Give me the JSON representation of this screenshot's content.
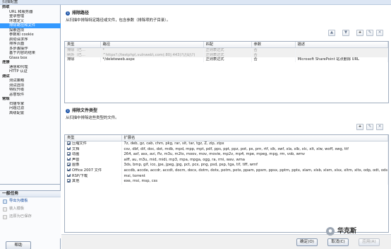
{
  "window": {
    "title": "扫描配置"
  },
  "sidebar": {
    "nav": [
      {
        "type": "group",
        "label": "抓取"
      },
      {
        "type": "item",
        "label": "URL 和服务器"
      },
      {
        "type": "item",
        "label": "登录管理"
      },
      {
        "type": "item",
        "label": "环境定义"
      },
      {
        "type": "item",
        "label": "排除路径和文件",
        "selected": true
      },
      {
        "type": "item",
        "label": "探索选项"
      },
      {
        "type": "item",
        "label": "参数和 cookie"
      },
      {
        "type": "item",
        "label": "启动请求序"
      },
      {
        "type": "item",
        "label": "排序页面"
      },
      {
        "type": "item",
        "label": "多步骤操作"
      },
      {
        "type": "item",
        "label": "基于内容的结果"
      },
      {
        "type": "item",
        "label": "Glass box"
      },
      {
        "type": "group",
        "label": "连接"
      },
      {
        "type": "item",
        "label": "通信和代理"
      },
      {
        "type": "item",
        "label": "HTTP 认证"
      },
      {
        "type": "group",
        "label": "测试"
      },
      {
        "type": "item",
        "label": "测试策略"
      },
      {
        "type": "item",
        "label": "测试选项"
      },
      {
        "type": "item",
        "label": "特权升级"
      },
      {
        "type": "item",
        "label": "恶意软件"
      },
      {
        "type": "group",
        "label": "常规"
      },
      {
        "type": "item",
        "label": "扫描专家"
      },
      {
        "type": "item",
        "label": "问题过滤"
      },
      {
        "type": "item",
        "label": "高级配置"
      }
    ],
    "tasks": {
      "header": "一般任务",
      "items": [
        {
          "label": "导出为模板",
          "enabled": true
        },
        {
          "label": "装入模板",
          "enabled": false
        },
        {
          "label": "还原为已保存",
          "enabled": false
        }
      ]
    },
    "help_label": "帮助"
  },
  "exclusion_paths": {
    "title": "排除路径",
    "description": "从扫描中排除特定路径或文件，包含参数（排除项的子目录）。",
    "columns": [
      "类型",
      "路径",
      "匹配",
      "参数",
      "描述"
    ],
    "rows": [
      {
        "type": "排除（已…",
        "path": "*",
        "match": "正则表达式",
        "params": "否",
        "desc": "",
        "dim": true
      },
      {
        "type": "例外（已…",
        "path": "^https?://testphp\\.vulnweb\\.com(:80|:443)?(/|$|\\?)",
        "match": "正则表达式",
        "params": "否",
        "desc": "",
        "dim": true
      },
      {
        "type": "排除",
        "path": "*/deleteweb.aspx",
        "match": "正则表达式",
        "params": "否",
        "desc": "Microsoft SharePoint 站点删除 URL",
        "dim": false
      }
    ]
  },
  "exclusion_types": {
    "title": "排除文件类型",
    "description": "从扫描中排除这些类型的文件。",
    "columns": [
      "类型",
      "扩展名"
    ],
    "rows": [
      {
        "type": "压缩文件",
        "ext": "7z, deb, gz, cab, chm, pkg, rar, sit, tar, tgz, Z, zip, zipx",
        "checked": true
      },
      {
        "type": "文档",
        "ext": "csv, dbf, dif, doc, dot, mdb, mpd, mpp, mpt, pdf, pps, ppt, ppz, pot, ps, prn, rtf, slk, swf, xla, xlb, xlc, xlt, xlw, woff, swg, ttf",
        "checked": true
      },
      {
        "type": "动画",
        "ext": "264, asf, asx, avi, flv, m3u, m2ts, moov, mov, movie, mp2v, mp4, mpe, mpeg, mpg, rm, vob, wmv",
        "checked": true
      },
      {
        "type": "声音",
        "ext": "aiff, au, m3u, mid, midi, mp3, mpa, mpga, ogg, ra, rmi, wav, wma",
        "checked": true
      },
      {
        "type": "图像",
        "ext": "3ds, bmp, gif, ico, jpe, jpeg, jpg, pct, pcx, png, psd, psp, tga, tif, tiff, wmf",
        "checked": true
      },
      {
        "type": "Office 2007 文件",
        "ext": "accdb, accde, accdr, accdt, docm, docx, dotm, dotx, potm, potx, ppam, ppsm, ppsx, pptm, pptx, xlam, xlsb, xlsm, xlsx, xltm, xltx, odp, odt, ods",
        "checked": true
      },
      {
        "type": "RSP/下载",
        "ext": "msi, torrent",
        "checked": true
      },
      {
        "type": "其他",
        "ext": "exe, msi, msp, css",
        "checked": true
      }
    ]
  },
  "buttons": {
    "ok": "确定(O)",
    "cancel": "取消(C)",
    "apply": "应用(A)"
  },
  "watermark": "华克斯"
}
